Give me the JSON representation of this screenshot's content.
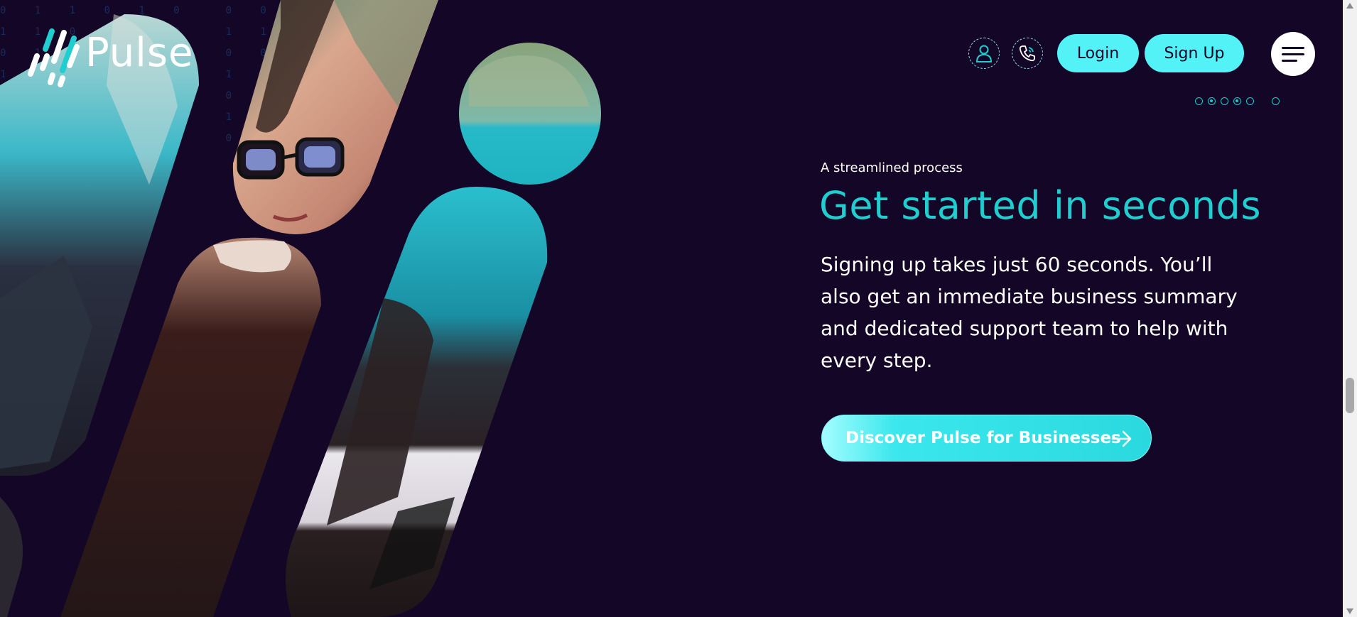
{
  "brand": {
    "name": "Pulse"
  },
  "header": {
    "login_label": "Login",
    "signup_label": "Sign Up",
    "icons": {
      "account": "user-icon",
      "contact": "phone-icon",
      "menu": "hamburger-menu-icon"
    }
  },
  "pagination": {
    "count": 6,
    "active_index": 3
  },
  "hero": {
    "eyebrow": "A streamlined process",
    "headline": "Get started in seconds",
    "body": "Signing up takes just 60 seconds. You’ll also get an immediate business summary and dedicated support team to help with every step.",
    "cta_label": "Discover Pulse for Businesses",
    "cta_icon": "arrow-right-icon"
  },
  "colors": {
    "background": "#140626",
    "accent": "#20cdcf",
    "button": "#52f2f7",
    "text": "#ffffff"
  }
}
